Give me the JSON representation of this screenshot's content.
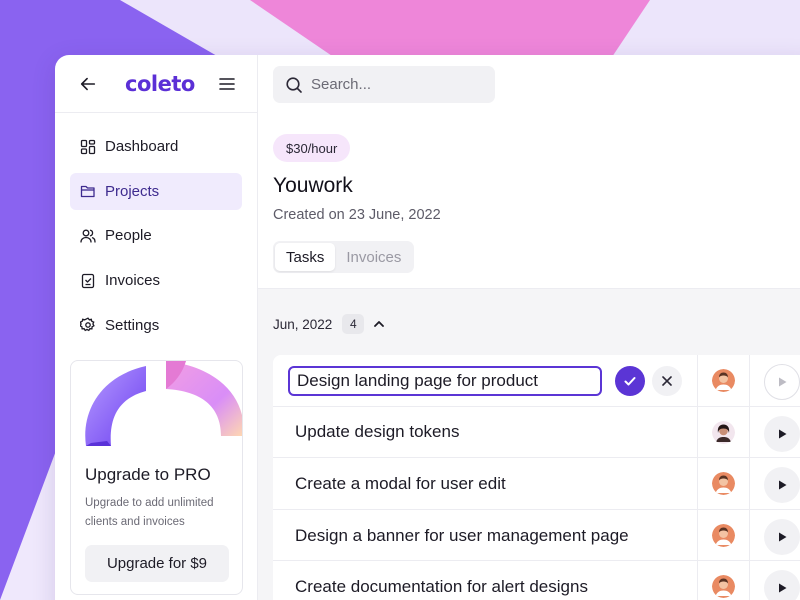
{
  "app": {
    "logo": "coleto",
    "brand_color": "#5b2fd6"
  },
  "sidebar": {
    "items": [
      {
        "label": "Dashboard",
        "icon": "dashboard-icon",
        "active": false
      },
      {
        "label": "Projects",
        "icon": "folder-icon",
        "active": true
      },
      {
        "label": "People",
        "icon": "people-icon",
        "active": false
      },
      {
        "label": "Invoices",
        "icon": "invoice-icon",
        "active": false
      },
      {
        "label": "Settings",
        "icon": "gear-icon",
        "active": false
      }
    ],
    "promo": {
      "title": "Upgrade to PRO",
      "text": "Upgrade to add unlimited clients and invoices",
      "button": "Upgrade for $9"
    }
  },
  "search": {
    "placeholder": "Search..."
  },
  "project": {
    "rate": "$30/hour",
    "title": "Youwork",
    "created": "Created on 23 June, 2022"
  },
  "tabs": [
    {
      "label": "Tasks",
      "active": true
    },
    {
      "label": "Invoices",
      "active": false
    }
  ],
  "group": {
    "label": "Jun, 2022",
    "count": "4"
  },
  "tasks": [
    {
      "name": "Design landing page for product",
      "editing": true
    },
    {
      "name": "Update design tokens",
      "editing": false
    },
    {
      "name": "Create a modal for user edit",
      "editing": false
    },
    {
      "name": "Design a banner for user management page",
      "editing": false
    },
    {
      "name": "Create documentation for alert designs",
      "editing": false
    }
  ],
  "colors": {
    "accent": "#5b35d5",
    "active_nav_bg": "#f0ebfd",
    "badge_bg": "#f6e6fb"
  }
}
